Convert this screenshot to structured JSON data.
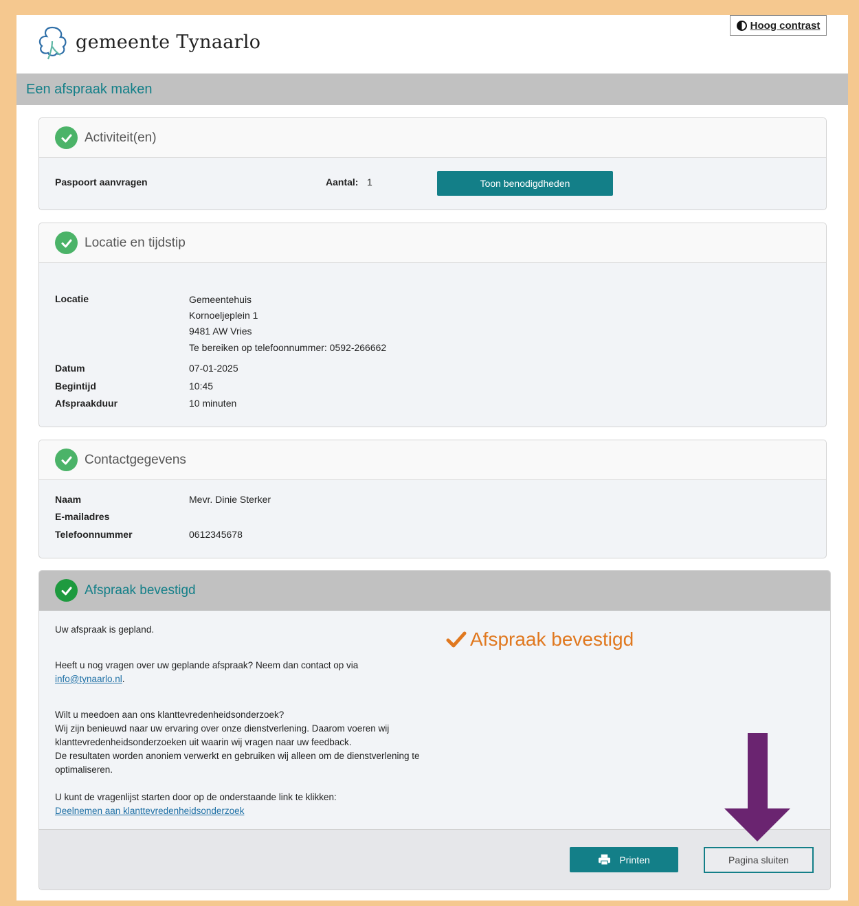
{
  "header": {
    "logo_text": "gemeente Tynaarlo",
    "contrast_button": "Hoog contrast"
  },
  "page_title": "Een afspraak maken",
  "activities": {
    "title": "Activiteit(en)",
    "item_label": "Paspoort aanvragen",
    "amount_label": "Aantal:",
    "amount_value": "1",
    "button": "Toon benodigdheden"
  },
  "location": {
    "title": "Locatie en tijdstip",
    "locatie_label": "Locatie",
    "locatie_lines": [
      "Gemeentehuis",
      "Kornoeljeplein 1",
      "9481 AW Vries",
      "Te bereiken op telefoonnummer: 0592-266662"
    ],
    "datum_label": "Datum",
    "datum_value": "07-01-2025",
    "begintijd_label": "Begintijd",
    "begintijd_value": "10:45",
    "duur_label": "Afspraakduur",
    "duur_value": "10 minuten"
  },
  "contact": {
    "title": "Contactgegevens",
    "naam_label": "Naam",
    "naam_value": "Mevr. Dinie Sterker",
    "email_label": "E-mailadres",
    "email_value": "",
    "telefoon_label": "Telefoonnummer",
    "telefoon_value": "0612345678"
  },
  "confirmation": {
    "title": "Afspraak bevestigd",
    "big_label": "Afspraak bevestigd",
    "planned": "Uw afspraak is gepland.",
    "questions": "Heeft u nog vragen over uw geplande afspraak? Neem dan contact op via",
    "email_link": "info@tynaarlo.nl",
    "survey_q": "Wilt u meedoen aan ons klanttevredenheidsonderzoek?",
    "survey_1": "Wij zijn benieuwd naar uw ervaring over onze dienstverlening. Daarom voeren wij",
    "survey_2": "klanttevredenheidsonderzoeken uit waarin wij vragen naar uw feedback.",
    "survey_3": "De resultaten worden anoniem verwerkt en gebruiken wij alleen om de dienstverlening te",
    "survey_4": "optimaliseren.",
    "survey_start": "U kunt de vragenlijst starten door op de onderstaande link te klikken:",
    "survey_link": "Deelnemen aan klanttevredenheidsonderzoek",
    "print_button": "Printen",
    "close_button": "Pagina sluiten"
  },
  "colors": {
    "teal": "#137f88",
    "orange": "#e0781f",
    "arrow_purple": "#6a2470",
    "check_green": "#4bb368",
    "border_orange": "#f5c88f"
  }
}
